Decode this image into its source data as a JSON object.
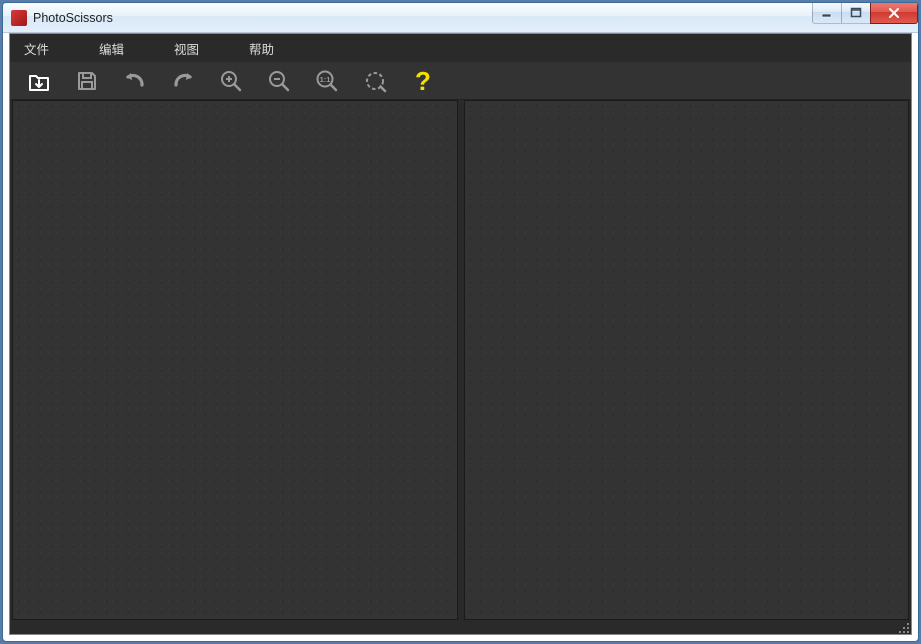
{
  "window": {
    "title": "PhotoScissors"
  },
  "menu": {
    "items": [
      {
        "label": "文件"
      },
      {
        "label": "编辑"
      },
      {
        "label": "视图"
      },
      {
        "label": "帮助"
      }
    ]
  },
  "toolbar": {
    "icons": [
      {
        "name": "open-icon"
      },
      {
        "name": "save-icon"
      },
      {
        "name": "undo-icon"
      },
      {
        "name": "redo-icon"
      },
      {
        "name": "zoom-in-icon"
      },
      {
        "name": "zoom-out-icon"
      },
      {
        "name": "zoom-actual-icon"
      },
      {
        "name": "zoom-fit-icon"
      },
      {
        "name": "help-icon"
      }
    ]
  },
  "colors": {
    "toolbar_icon": "#bdbdbd",
    "toolbar_icon_active": "#ffffff",
    "help_icon": "#f5e000",
    "panel_bg": "#333333",
    "app_bg": "#2a2a2a"
  }
}
